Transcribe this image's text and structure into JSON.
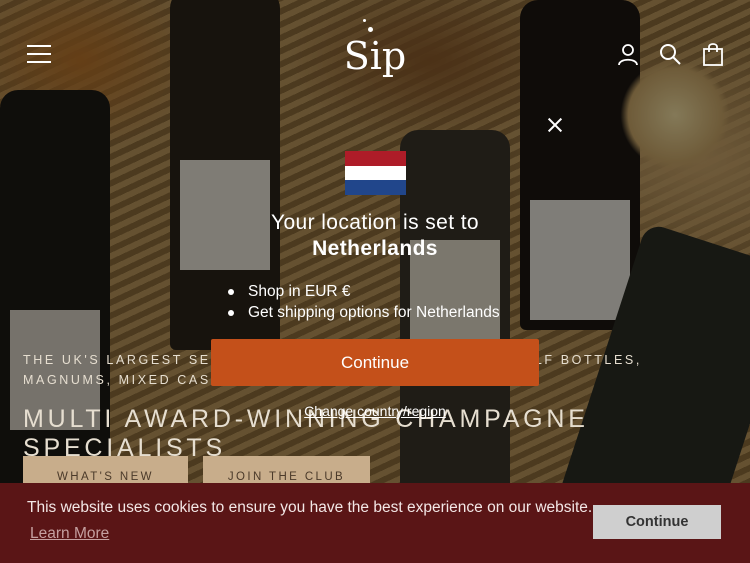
{
  "header": {
    "logo_text": "Sip",
    "menu_icon": "hamburger-menu-icon",
    "account_icon": "user-account-icon",
    "search_icon": "search-icon",
    "cart_icon": "shopping-bag-icon"
  },
  "hero": {
    "tagline": "THE UK'S LARGEST SELECTION OF GROWER CHAMPAGNE: HALF BOTTLES, MAGNUMS, MIXED CASES, MONTHLY SUBSCRIPTIONS",
    "headline": "MULTI AWARD-WINNING CHAMPAGNE SPECIALISTS",
    "buttons": {
      "whats_new": "WHAT'S NEW",
      "join_club": "JOIN THE CLUB"
    }
  },
  "location_popup": {
    "flag": "netherlands-flag",
    "flag_colors": [
      "#AE1C28",
      "#FFFFFF",
      "#21468B"
    ],
    "line1": "Your location is set to",
    "country": "Netherlands",
    "perks": [
      "Shop in EUR €",
      "Get shipping options for Netherlands"
    ],
    "continue_label": "Continue",
    "change_label": "Change country/region",
    "close_icon": "close-icon",
    "accent_color": "#C4501A"
  },
  "cookie_bar": {
    "message": "This website uses cookies to ensure you have the best experience on our website.",
    "learn_more": "Learn More",
    "button_label": "Continue",
    "bg_color": "#5A1516"
  }
}
